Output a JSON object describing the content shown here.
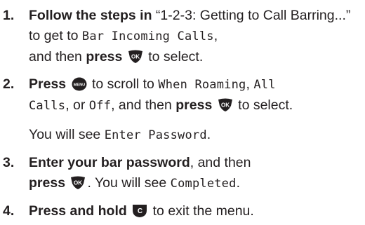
{
  "steps": [
    {
      "number": "1.",
      "bold1": "Follow the steps in",
      "text1": " “1-2-3: Getting to Call Barring...” to get to ",
      "screen1": "Bar Incoming Calls",
      "text2": ",",
      "text3": "and then ",
      "bold2": "press",
      "icon": "ok-key-icon",
      "text4": " to select."
    },
    {
      "number": "2.",
      "bold1": "Press",
      "icon1": "menu-key-icon",
      "text1": " to scroll to ",
      "screen1": "When Roaming",
      "text2": ", ",
      "screen2": "All",
      "screen3": "Calls",
      "text3": ", or ",
      "screen4": "Off",
      "text4": ", and then ",
      "bold2": "press",
      "icon2": "ok-key-icon",
      "text5": " to select."
    },
    {
      "number": "3.",
      "bold1": "Enter your bar password",
      "text1": ", and then",
      "bold2": "press",
      "icon": "ok-key-icon",
      "text2": ". You will see ",
      "screen1": "Completed",
      "text3": "."
    },
    {
      "number": "4.",
      "bold1": "Press and hold",
      "icon": "clear-key-icon",
      "text1": " to exit the menu."
    }
  ],
  "note": {
    "text1": "You will see ",
    "screen1": "Enter Password",
    "text2": "."
  },
  "colors": {
    "text": "#231f20",
    "key": "#231f20",
    "key_glyph": "#ffffff"
  }
}
